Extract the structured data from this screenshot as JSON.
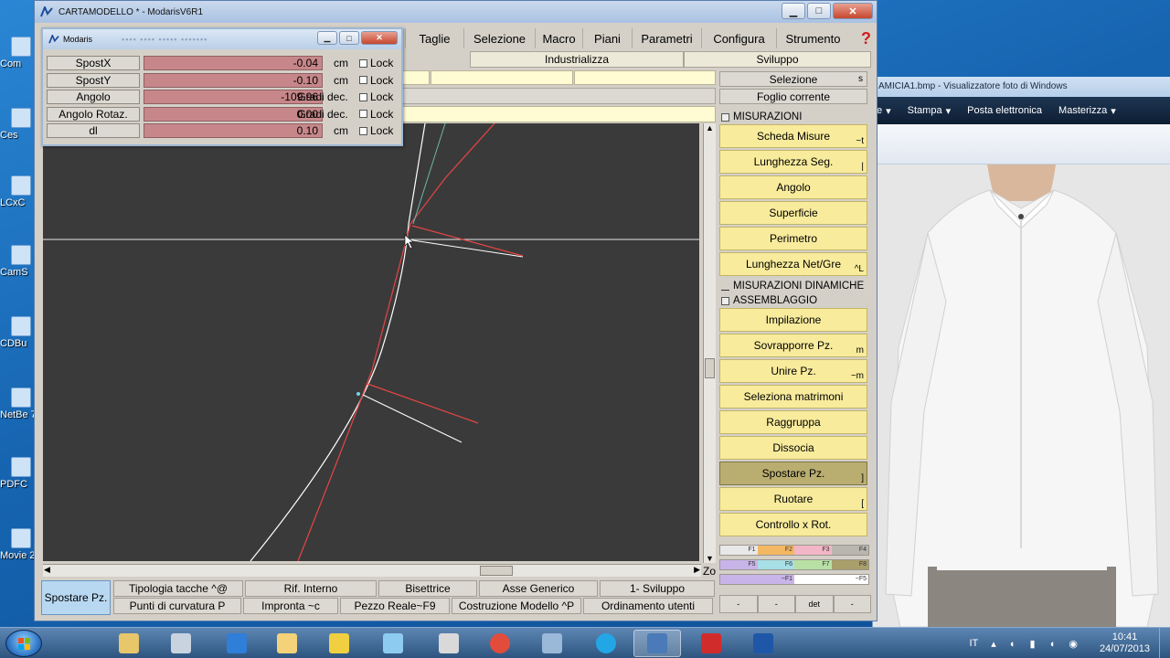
{
  "desktop": {
    "icons": [
      "Com",
      "Ces",
      "LCxC",
      "CamS",
      "CDBu",
      "NetBe 7.",
      "PDFC",
      "Movie 2"
    ]
  },
  "photo_viewer": {
    "title": "AMICIA1.bmp - Visualizzatore foto di Windows",
    "menu": [
      "e",
      "Stampa",
      "Posta elettronica",
      "Masterizza"
    ]
  },
  "app": {
    "title": "CARTAMODELLO * - ModarisV6R1",
    "menu": [
      "Taglie",
      "Selezione",
      "Macro",
      "Piani",
      "Parametri",
      "Configura",
      "Strumento"
    ],
    "subbar": [
      "Industrializza",
      "Sviluppo"
    ],
    "right_panel": {
      "header": "Selezione",
      "header_short": "s",
      "foglio": "Foglio corrente",
      "section_misurazioni": "MISURAZIONI",
      "section_dinamiche": "MISURAZIONI DINAMICHE",
      "section_assemblaggio": "ASSEMBLAGGIO",
      "misurazioni_buttons": [
        {
          "label": "Scheda Misure",
          "short": "~t"
        },
        {
          "label": "Lunghezza Seg.",
          "short": "|"
        },
        {
          "label": "Angolo",
          "short": ""
        },
        {
          "label": "Superficie",
          "short": ""
        },
        {
          "label": "Perimetro",
          "short": ""
        },
        {
          "label": "Lunghezza Net/Gre",
          "short": "^L"
        }
      ],
      "assemblaggio_buttons": [
        {
          "label": "Impilazione",
          "short": ""
        },
        {
          "label": "Sovrapporre Pz.",
          "short": "m"
        },
        {
          "label": "Unire Pz.",
          "short": "~m"
        },
        {
          "label": "Seleziona matrimoni",
          "short": ""
        },
        {
          "label": "Raggruppa",
          "short": ""
        },
        {
          "label": "Dissocia",
          "short": ""
        },
        {
          "label": "Spostare Pz.",
          "short": "]"
        },
        {
          "label": "Ruotare",
          "short": "["
        },
        {
          "label": "Controllo x Rot.",
          "short": ""
        }
      ],
      "color_rows": [
        [
          {
            "label": "F1",
            "color": "#e8e8e8"
          },
          {
            "label": "F2",
            "color": "#f4b862"
          },
          {
            "label": "F3",
            "color": "#f2b6c6"
          },
          {
            "label": "F4",
            "color": "#b9b6b0"
          }
        ],
        [
          {
            "label": "F5",
            "color": "#c8b4e8"
          },
          {
            "label": "F6",
            "color": "#a6dfe6"
          },
          {
            "label": "F7",
            "color": "#b8e0a4"
          },
          {
            "label": "F8",
            "color": "#a89f6a"
          }
        ],
        [
          {
            "label": "~F1",
            "color": "#c8b4e8"
          },
          {
            "label": "~F5",
            "color": "#ffffff"
          }
        ]
      ],
      "bottom_buttons": [
        "-",
        "-",
        "det",
        "-"
      ]
    },
    "zoom_label": "Zo",
    "bottom_toolbar": {
      "active": "Spostare Pz.",
      "row1": [
        "Tipologia tacche    ^@",
        "Rif. Interno",
        "Bisettrice",
        "Asse Generico",
        "1- Sviluppo"
      ],
      "row2": [
        "Punti di curvatura  P",
        "Impronta ~c",
        "Pezzo Reale~F9",
        "Costruzione Modello ^P",
        "Ordinamento utenti"
      ]
    }
  },
  "modaris_panel": {
    "title": "Modaris",
    "rows": [
      {
        "label": "SpostX",
        "value": "-0.04",
        "unit": "cm",
        "lock": "Lock"
      },
      {
        "label": "SpostY",
        "value": "-0.10",
        "unit": "cm",
        "lock": "Lock"
      },
      {
        "label": "Angolo",
        "value": "-109.96",
        "unit": "Gradi dec.",
        "lock": "Lock"
      },
      {
        "label": "Angolo Rotaz.",
        "value": "0.00",
        "unit": "Gradi dec.",
        "lock": "Lock"
      },
      {
        "label": "dl",
        "value": "0.10",
        "unit": "cm",
        "lock": "Lock"
      }
    ]
  },
  "taskbar": {
    "lang": "IT",
    "time": "10:41",
    "date": "24/07/2013",
    "apps": [
      {
        "name": "explorer",
        "color": "#e8c66a"
      },
      {
        "name": "calculator",
        "color": "#c9d3df"
      },
      {
        "name": "teamviewer",
        "color": "#2f7ed8"
      },
      {
        "name": "outlook",
        "color": "#f3d27a"
      },
      {
        "name": "glasses",
        "color": "#f0d040"
      },
      {
        "name": "paint",
        "color": "#8ecbf0"
      },
      {
        "name": "tool",
        "color": "#d9d9d9"
      },
      {
        "name": "chrome",
        "color": "#e24c3a"
      },
      {
        "name": "window",
        "color": "#9ab8d8"
      },
      {
        "name": "skype",
        "color": "#22a6e6"
      },
      {
        "name": "modaris",
        "color": "#4a7ab8"
      },
      {
        "name": "acrobat",
        "color": "#d12c2c"
      },
      {
        "name": "app",
        "color": "#1f57a8"
      }
    ]
  }
}
